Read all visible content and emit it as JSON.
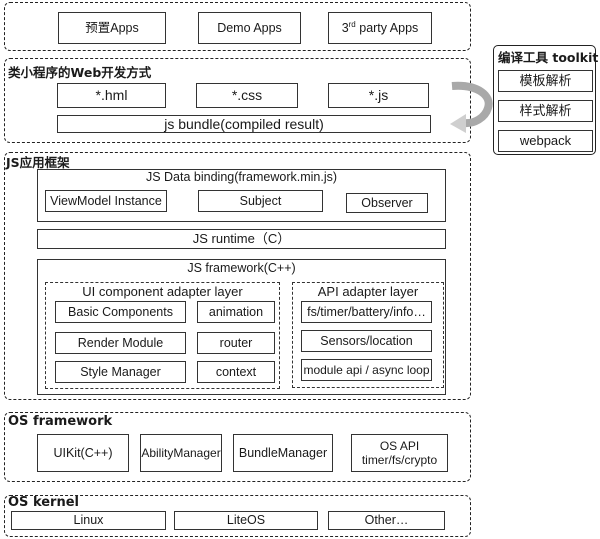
{
  "apps_layer": {
    "items": [
      {
        "label": "预置Apps"
      },
      {
        "label_prefix": "3",
        "label_sup": "rd",
        "label_rest": " party Apps"
      },
      {
        "label": "Demo Apps"
      }
    ]
  },
  "web_dev": {
    "title": "类小程序的Web开发方式",
    "files": [
      "*.hml",
      "*.css",
      "*.js"
    ],
    "bundle": "js bundle(compiled result)"
  },
  "toolkit": {
    "title": "编译工具 toolkit",
    "items": [
      "模板解析",
      "样式解析",
      "webpack"
    ]
  },
  "js_framework_layer": {
    "title": "JS应用框架",
    "data_binding": {
      "title": "JS Data binding(framework.min.js)",
      "items": [
        "ViewModel Instance",
        "Subject",
        "Observer"
      ]
    },
    "runtime": "JS runtime（C）",
    "framework": {
      "title": "JS framework(C++)",
      "ui_adapter": {
        "title": "UI component adapter layer",
        "items": [
          "Basic Components",
          "animation",
          "Render Module",
          "router",
          "Style Manager",
          "context"
        ]
      },
      "api_adapter": {
        "title": "API adapter layer",
        "items": [
          "fs/timer/battery/info…",
          "Sensors/location",
          "module api / async loop"
        ]
      }
    }
  },
  "os_framework": {
    "title": "OS framework",
    "items": [
      "UIKit(C++)",
      "AbilityManager",
      "BundleManager"
    ],
    "os_api": {
      "line1": "OS API",
      "line2": "timer/fs/crypto"
    }
  },
  "os_kernel": {
    "title": "OS kernel",
    "items": [
      "Linux",
      "LiteOS",
      "Other…"
    ]
  }
}
